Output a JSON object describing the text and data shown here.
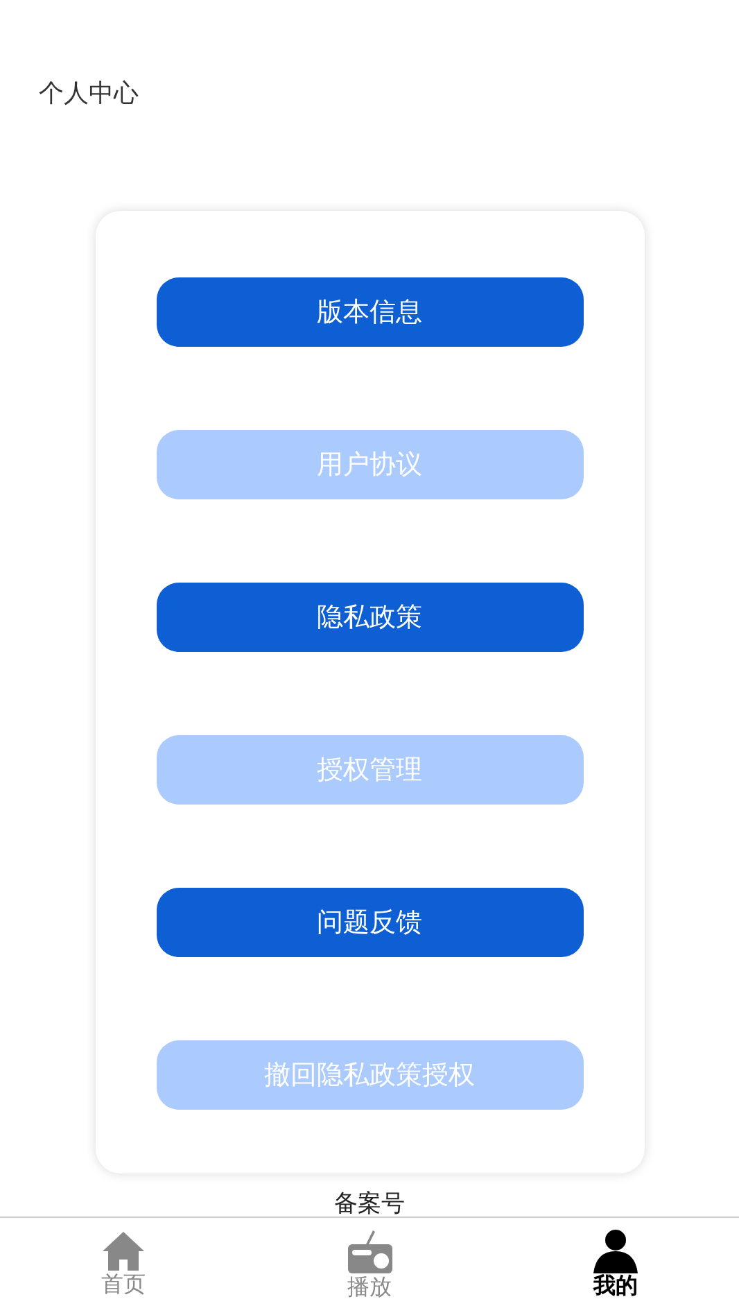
{
  "title": "个人中心",
  "buttons": [
    {
      "label": "版本信息",
      "highlighted": true
    },
    {
      "label": "用户协议",
      "highlighted": false
    },
    {
      "label": "隐私政策",
      "highlighted": true
    },
    {
      "label": "授权管理",
      "highlighted": false
    },
    {
      "label": "问题反馈",
      "highlighted": true
    },
    {
      "label": "撤回隐私政策授权",
      "highlighted": false
    }
  ],
  "footer": "备案号",
  "tabs": [
    {
      "label": "首页",
      "kind": "home",
      "selected": false
    },
    {
      "label": "播放",
      "kind": "radio",
      "selected": false
    },
    {
      "label": "我的",
      "kind": "user",
      "selected": true
    }
  ]
}
